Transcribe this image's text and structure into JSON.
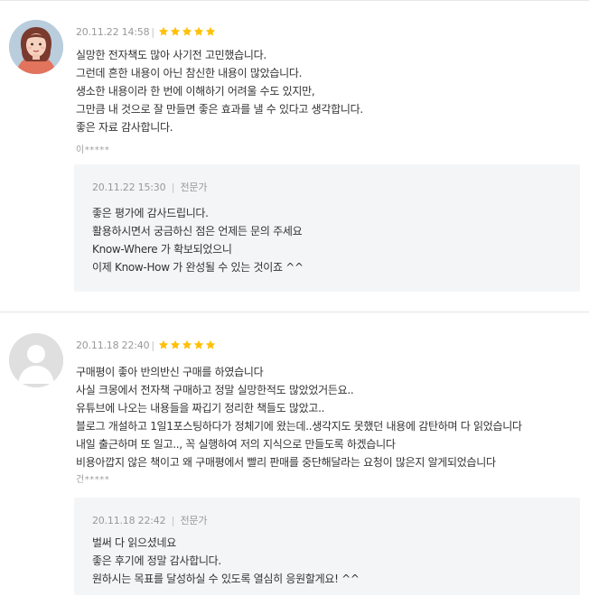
{
  "reviews": [
    {
      "date": "20.11.22 14:58",
      "separator": "|",
      "rating": 5,
      "lines": [
        "실망한 전자책도 많아 사기전 고민했습니다.",
        "그런데 흔한 내용이 아닌 참신한 내용이 많았습니다.",
        "생소한 내용이라 한 번에 이해하기 어려울 수도 있지만,",
        "그만큼 내 것으로 잘 만들면 좋은 효과를 낼 수 있다고 생각합니다.",
        "좋은 자료 감사합니다."
      ],
      "author": "이*****",
      "reply": {
        "date": "20.11.22 15:30",
        "separator": "|",
        "role": "전문가",
        "lines": [
          "좋은 평가에 감사드립니다.",
          "활용하시면서 궁금하신 점은 언제든 문의 주세요",
          "Know-Where 가 확보되었으니",
          "이제 Know-How 가 완성될 수 있는 것이죠 ^^"
        ]
      }
    },
    {
      "date": "20.11.18 22:40",
      "separator": "|",
      "rating": 5,
      "lines": [
        "구매평이 좋아 반의반신 구매를 하였습니다",
        "사실 크몽에서 전자책 구매하고 정말 실망한적도 많았었거든요..",
        "유튜브에 나오는 내용들을 짜깁기 정리한 책들도 많았고..",
        "블로그 개설하고 1일1포스팅하다가 정체기에 왔는데..생각지도 못했던 내용에 감탄하며 다 읽었습니다",
        "내일 출근하며 또 일고.., 꼭 실행하여 저의 지식으로 만들도록 하겠습니다",
        "비용아깝지 않은 책이고 왜 구매평에서 빨리 판매를 중단해달라는 요청이 많은지 알게되었습니다"
      ],
      "author": "건*****",
      "reply": {
        "date": "20.11.18 22:42",
        "separator": "|",
        "role": "전문가",
        "lines": [
          "벌써 다 읽으셨네요",
          "좋은 후기에 정말 감사합니다.",
          "원하시는 목표를 달성하실 수 있도록 열심히 응원할게요! ^^"
        ]
      }
    }
  ],
  "colors": {
    "star": "#ffc107",
    "reply_bg": "#f4f5f7",
    "meta_text": "#999999",
    "body_text": "#333333"
  },
  "icons": {
    "avatar_1": "user-photo",
    "avatar_2": "default-user-icon",
    "star": "star-icon"
  }
}
